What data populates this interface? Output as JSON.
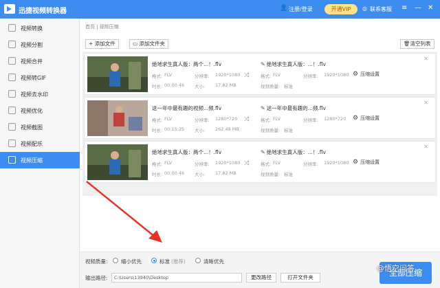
{
  "titlebar": {
    "app_title": "迅捷视频转换器",
    "login": "注册/登录",
    "vip": "开通VIP",
    "support": "联系客服"
  },
  "sidebar": {
    "items": [
      {
        "label": "视频转换"
      },
      {
        "label": "视频分割"
      },
      {
        "label": "视频合并"
      },
      {
        "label": "视频转GIF"
      },
      {
        "label": "视频去水印"
      },
      {
        "label": "视频优化"
      },
      {
        "label": "视频截图"
      },
      {
        "label": "视频配乐"
      },
      {
        "label": "视频压缩"
      }
    ]
  },
  "main": {
    "breadcrumb": "首页 | 视频压缩",
    "add_file": "+ 添加文件",
    "add_folder": "添加文件夹",
    "clear_list": "清空列表"
  },
  "files": [
    {
      "source_name": "绝地求生真人版：两个...！.flv",
      "source_format_label": "格式:",
      "source_format": "FLV",
      "source_res_label": "分辨率:",
      "source_res": "1920*1080",
      "source_duration_label": "时长:",
      "source_duration": "00:00:46",
      "source_size_label": "大小:",
      "source_size": "17.82 MB",
      "output_name": "绝地求生真人版：...！.flv",
      "output_format_label": "格式:",
      "output_format": "FLV",
      "output_res_label": "分辨率:",
      "output_res": "1920*1080",
      "output_quality_label": "视频质量:",
      "output_quality": "标准",
      "settings_label": "压缩设置"
    },
    {
      "source_name": "这一年中最有趣的视频...频.flv",
      "source_format_label": "格式:",
      "source_format": "FLV",
      "source_res_label": "分辨率:",
      "source_res": "1280*720",
      "source_duration_label": "时长:",
      "source_duration": "00:15:25",
      "source_size_label": "大小:",
      "source_size": "262.48 MB",
      "output_name": "这一年中最有趣的...频.flv",
      "output_format_label": "格式:",
      "output_format": "FLV",
      "output_res_label": "分辨率:",
      "output_res": "1280*720",
      "output_quality_label": "视频质量:",
      "output_quality": "标准",
      "settings_label": "压缩设置"
    },
    {
      "source_name": "绝地求生真人版：两个...！.flv",
      "source_format_label": "格式:",
      "source_format": "FLV",
      "source_res_label": "分辨率:",
      "source_res": "1920*1080",
      "source_duration_label": "时长:",
      "source_duration": "00:00:46",
      "source_size_label": "大小:",
      "source_size": "17.82 MB",
      "output_name": "绝地求生真人版：...！.flv",
      "output_format_label": "格式:",
      "output_format": "FLV",
      "output_res_label": "分辨率:",
      "output_res": "1920*1080",
      "output_quality_label": "视频质量:",
      "output_quality": "标准",
      "settings_label": "压缩设置"
    }
  ],
  "bottom": {
    "quality_label": "视频质量:",
    "options": [
      {
        "label": "缩小优先",
        "selected": false
      },
      {
        "label": "标准",
        "selected": true
      },
      {
        "label": "清晰优先",
        "selected": false
      }
    ],
    "recommended": "(推荐)",
    "path_label": "输出路径:",
    "path_value": "C:\\Users\\13940\\Desktop",
    "change_path": "更改路径",
    "open_folder": "打开文件夹",
    "start": "全部压缩"
  },
  "watermark": "@悟空问答",
  "colors": {
    "accent": "#3d8cf0",
    "arrow": "#e8302a",
    "vip": "#ffe38a"
  }
}
